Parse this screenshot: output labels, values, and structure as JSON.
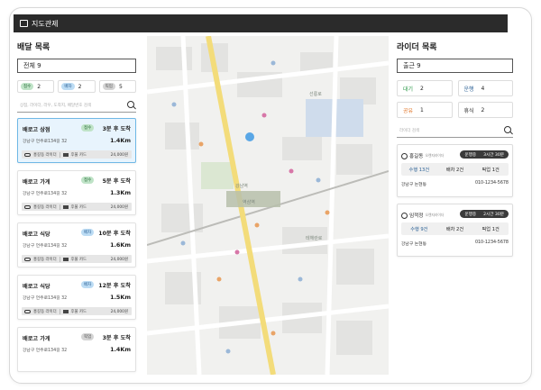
{
  "app": {
    "title": "지도관제"
  },
  "delivery": {
    "title": "배달 목록",
    "filter": "전체 9",
    "chips": [
      {
        "label": "접수",
        "count": "2"
      },
      {
        "label": "배차",
        "count": "2"
      },
      {
        "label": "픽업",
        "count": "5"
      }
    ],
    "search_placeholder": "상점, 라이더, 라우, 도착지, 배달번호 검색",
    "orders": [
      {
        "store": "배로고 상점",
        "status": "접수",
        "eta": "3분 후 도착",
        "address": "강남구 언주로134길 32",
        "distance": "1.4Km",
        "rider": "홍길동 라이더",
        "payment": "후불 카드",
        "amount": "24,000원"
      },
      {
        "store": "배로고 가게",
        "status": "접수",
        "eta": "5분 후 도착",
        "address": "강남구 언주로134길 32",
        "distance": "1.3Km",
        "rider": "홍길동 라이더",
        "payment": "후불 카드",
        "amount": "24,000원"
      },
      {
        "store": "배로고 식당",
        "status": "배차",
        "eta": "10분 후 도착",
        "address": "강남구 언주로134길 32",
        "distance": "1.6Km",
        "rider": "홍길동 라이더",
        "payment": "후불 카드",
        "amount": "24,000원"
      },
      {
        "store": "배로고 식당",
        "status": "배차",
        "eta": "12분 후 도착",
        "address": "강남구 언주로134길 32",
        "distance": "1.5Km",
        "rider": "홍길동 라이더",
        "payment": "후불 카드",
        "amount": "24,000원"
      },
      {
        "store": "배로고 가게",
        "status": "픽업",
        "eta": "3분 후 도착",
        "address": "강남구 언주로134길 32",
        "distance": "1.4Km",
        "rider": "",
        "payment": "",
        "amount": ""
      }
    ]
  },
  "riders": {
    "title": "라이더 목록",
    "filter": "출근 9",
    "stats": [
      {
        "label": "대기",
        "count": "2",
        "color": "#2e9a4a"
      },
      {
        "label": "운행",
        "count": "4",
        "color": "#2d6296"
      },
      {
        "label": "공유",
        "count": "1",
        "color": "#e07020"
      },
      {
        "label": "휴식",
        "count": "2",
        "color": "#444444"
      }
    ],
    "search_placeholder": "라이더 검색",
    "list": [
      {
        "name": "홍길동",
        "sub": "오렌지라이더",
        "state": "운행중",
        "time": "3시간 30분",
        "stat1": "수행 13건",
        "stat2": "배차 2건",
        "stat3": "픽업 1건",
        "area": "강남구 논현동",
        "phone": "010-1234-5678"
      },
      {
        "name": "임꺽정",
        "sub": "오렌지라이더",
        "state": "운행중",
        "time": "2시간 30분",
        "stat1": "수행 9건",
        "stat2": "배차 2건",
        "stat3": "픽업 1건",
        "area": "강남구 논현동",
        "phone": "010-1234-5678"
      }
    ]
  },
  "map": {
    "labels": [
      {
        "text": "역삼역"
      },
      {
        "text": "강남역"
      },
      {
        "text": "선릉로"
      },
      {
        "text": "테헤란로"
      }
    ]
  }
}
